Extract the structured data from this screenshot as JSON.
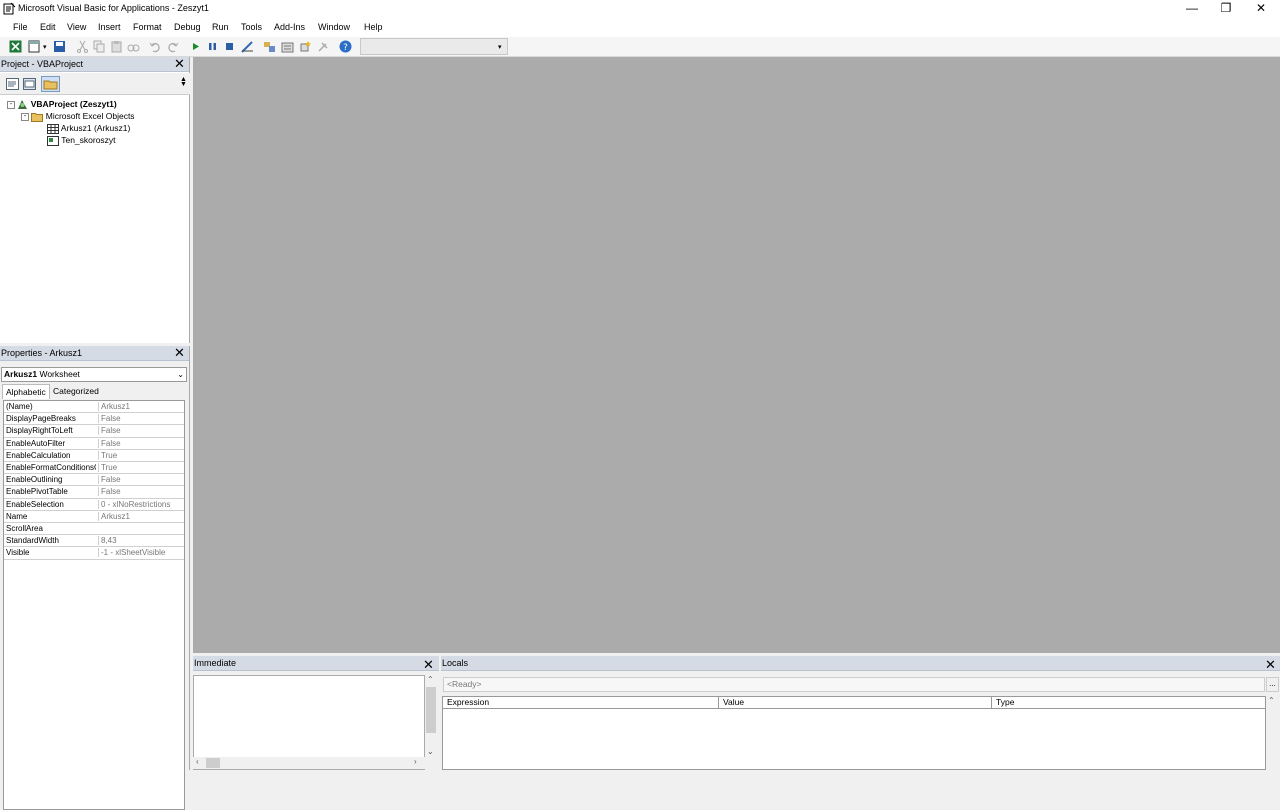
{
  "window": {
    "title": "Microsoft Visual Basic for Applications - Zeszyt1",
    "buttons": {
      "minimize": "—",
      "restore": "❐",
      "close": "✕"
    }
  },
  "menu": [
    "File",
    "Edit",
    "View",
    "Insert",
    "Format",
    "Debug",
    "Run",
    "Tools",
    "Add-Ins",
    "Window",
    "Help"
  ],
  "project": {
    "title": "Project - VBAProject",
    "root": "VBAProject (Zeszyt1)",
    "folder": "Microsoft Excel Objects",
    "items": [
      "Arkusz1 (Arkusz1)",
      "Ten_skoroszyt"
    ]
  },
  "properties": {
    "title": "Properties - Arkusz1",
    "object_name": "Arkusz1",
    "object_type": "Worksheet",
    "tabs": [
      "Alphabetic",
      "Categorized"
    ],
    "rows": [
      {
        "name": "(Name)",
        "value": "Arkusz1"
      },
      {
        "name": "DisplayPageBreaks",
        "value": "False"
      },
      {
        "name": "DisplayRightToLeft",
        "value": "False"
      },
      {
        "name": "EnableAutoFilter",
        "value": "False"
      },
      {
        "name": "EnableCalculation",
        "value": "True"
      },
      {
        "name": "EnableFormatConditionsCalculation",
        "value": "True"
      },
      {
        "name": "EnableOutlining",
        "value": "False"
      },
      {
        "name": "EnablePivotTable",
        "value": "False"
      },
      {
        "name": "EnableSelection",
        "value": "0 - xlNoRestrictions"
      },
      {
        "name": "Name",
        "value": "Arkusz1"
      },
      {
        "name": "ScrollArea",
        "value": ""
      },
      {
        "name": "StandardWidth",
        "value": "8,43"
      },
      {
        "name": "Visible",
        "value": "-1 - xlSheetVisible"
      }
    ]
  },
  "immediate": {
    "title": "Immediate"
  },
  "locals": {
    "title": "Locals",
    "context": "<Ready>",
    "columns": [
      "Expression",
      "Value",
      "Type"
    ],
    "ellipsis": "..."
  },
  "colors": {
    "mdi_background": "#ababab",
    "panel_header": "#d4dbe4"
  }
}
